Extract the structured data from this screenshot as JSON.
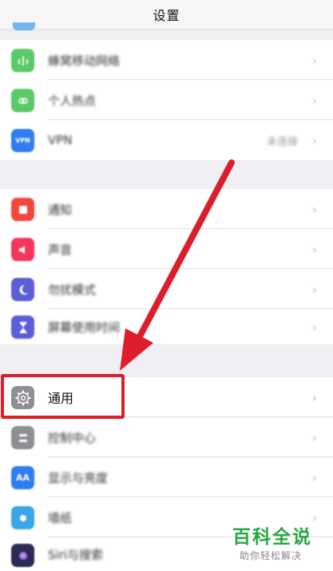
{
  "nav": {
    "title": "设置"
  },
  "group1": {
    "rows": [
      {
        "label": "蜂窝移动网络",
        "icon": "antenna-icon",
        "color": "#5bc86a"
      },
      {
        "label": "个人热点",
        "icon": "link-icon",
        "color": "#5bc86a"
      },
      {
        "label": "VPN",
        "value": "未连接",
        "icon": "vpn-icon",
        "color": "#2f7df0"
      }
    ]
  },
  "group2": {
    "rows": [
      {
        "label": "通知",
        "icon": "bell-icon",
        "color": "#f2473d"
      },
      {
        "label": "声音",
        "icon": "speaker-icon",
        "color": "#f2375a"
      },
      {
        "label": "勿扰模式",
        "icon": "moon-icon",
        "color": "#5b5ed6"
      },
      {
        "label": "屏幕使用时间",
        "icon": "hourglass-icon",
        "color": "#5b5ed6"
      }
    ]
  },
  "group3": {
    "rows": [
      {
        "label": "通用",
        "icon": "gear-icon",
        "color": "#8e8e93"
      },
      {
        "label": "控制中心",
        "icon": "switches-icon",
        "color": "#8e8e93"
      },
      {
        "label": "显示与亮度",
        "icon": "aa-icon",
        "color": "#2f7df0"
      },
      {
        "label": "墙纸",
        "icon": "flower-icon",
        "color": "#3aa6e6"
      },
      {
        "label": "Siri与搜索",
        "icon": "siri-icon",
        "color": "#2b2b55"
      }
    ]
  },
  "watermark": {
    "title": "百科全说",
    "subtitle": "助你轻松解决"
  },
  "colors": {
    "annotation": "#dc1e2a",
    "watermark": "#27a745"
  }
}
